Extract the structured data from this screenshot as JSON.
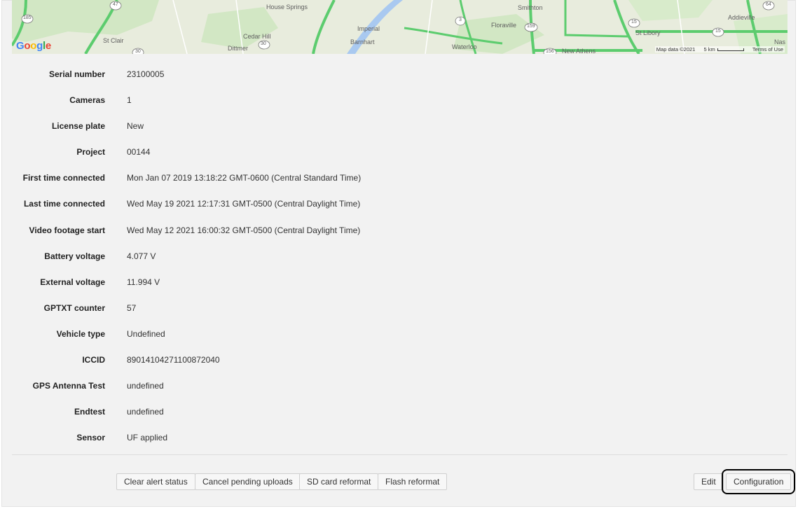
{
  "map": {
    "logo": "Google",
    "places": [
      "House Springs",
      "Smithton",
      "Addieville",
      "Imperial",
      "Floraville",
      "St Clair",
      "Cedar Hill",
      "Barnhart",
      "St Libory",
      "Dittmer",
      "Waterloo",
      "New Athens",
      "Nas"
    ],
    "route_shields": [
      "185",
      "47",
      "30",
      "3",
      "159",
      "15",
      "15",
      "156",
      "64",
      "30"
    ],
    "attribution": {
      "map_data": "Map data ©2021",
      "scale": "5 km",
      "terms": "Terms of Use"
    },
    "colors": {
      "land": "#e8ecdd",
      "park": "#cfe6c0",
      "highway": "#5ccc6e",
      "water": "#a9c9f0"
    }
  },
  "details": [
    {
      "label": "Serial number",
      "value": "23100005"
    },
    {
      "label": "Cameras",
      "value": "1"
    },
    {
      "label": "License plate",
      "value": "New"
    },
    {
      "label": "Project",
      "value": "00144"
    },
    {
      "label": "First time connected",
      "value": "Mon Jan 07 2019 13:18:22 GMT-0600 (Central Standard Time)"
    },
    {
      "label": "Last time connected",
      "value": "Wed May 19 2021 12:17:31 GMT-0500 (Central Daylight Time)"
    },
    {
      "label": "Video footage start",
      "value": "Wed May 12 2021 16:00:32 GMT-0500 (Central Daylight Time)"
    },
    {
      "label": "Battery voltage",
      "value": "4.077 V"
    },
    {
      "label": "External voltage",
      "value": "11.994 V"
    },
    {
      "label": "GPTXT counter",
      "value": "57"
    },
    {
      "label": "Vehicle type",
      "value": "Undefined"
    },
    {
      "label": "ICCID",
      "value": "89014104271100872040"
    },
    {
      "label": "GPS Antenna Test",
      "value": "undefined"
    },
    {
      "label": "Endtest",
      "value": "undefined"
    },
    {
      "label": "Sensor",
      "value": "UF applied"
    }
  ],
  "actions": {
    "clear_alert_status": "Clear alert status",
    "cancel_pending_uploads": "Cancel pending uploads",
    "sd_card_reformat": "SD card reformat",
    "flash_reformat": "Flash reformat",
    "edit": "Edit",
    "configuration": "Configuration"
  }
}
